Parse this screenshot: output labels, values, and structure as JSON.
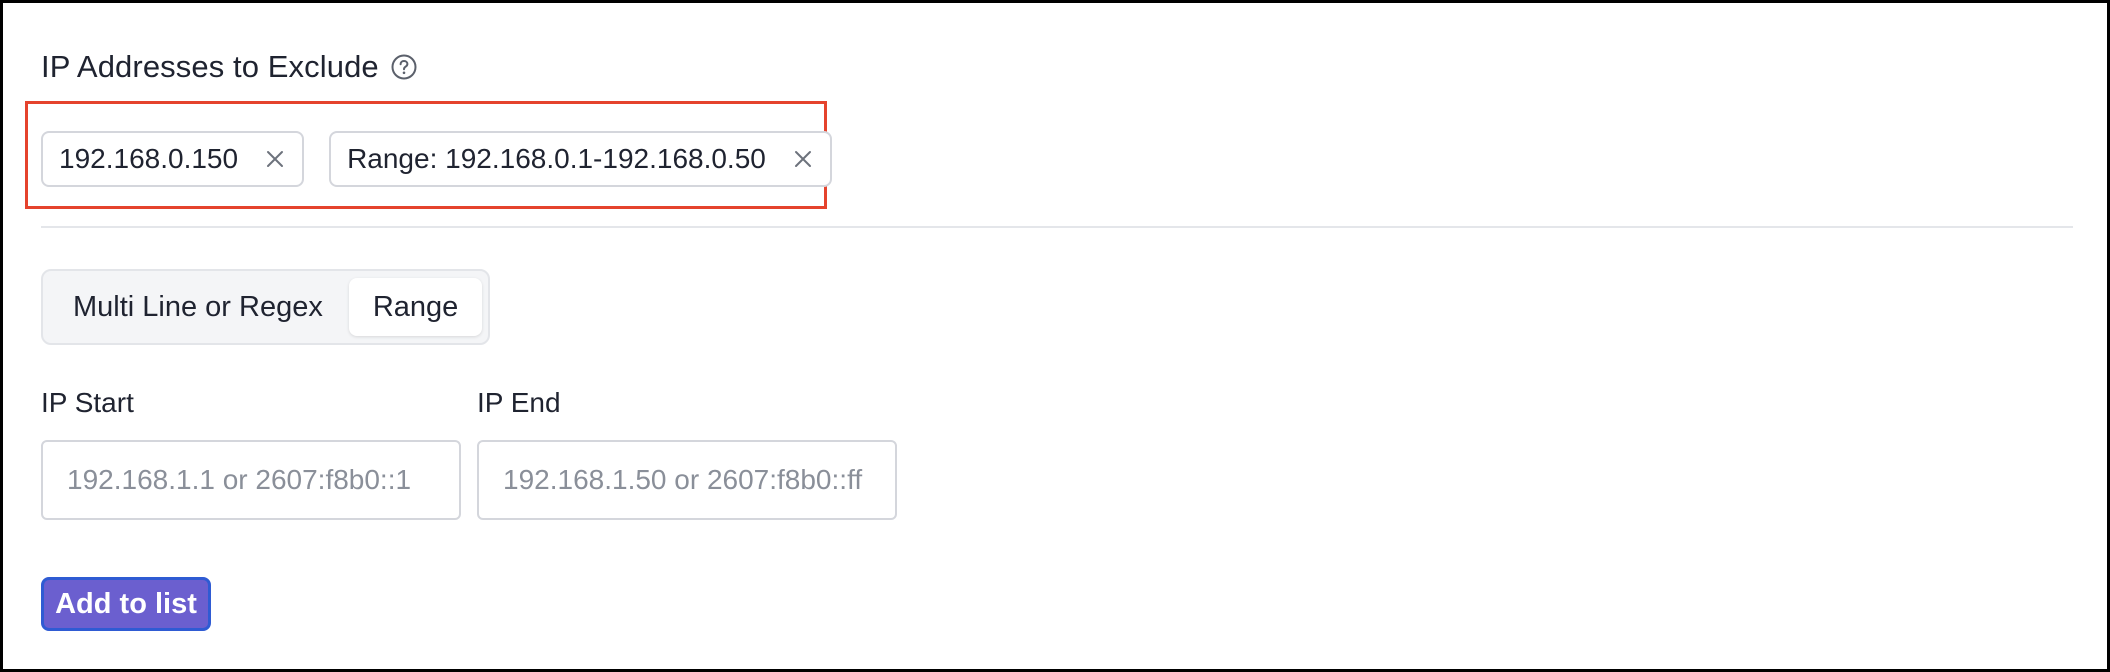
{
  "section": {
    "title": "IP Addresses to Exclude",
    "help_icon": "question-circle-icon"
  },
  "chips": [
    {
      "label": "192.168.0.150",
      "remove_icon": "close-icon"
    },
    {
      "label": "Range: 192.168.0.1-192.168.0.50",
      "remove_icon": "close-icon"
    }
  ],
  "mode_toggle": {
    "options": [
      "Multi Line or Regex",
      "Range"
    ],
    "selected": "Range"
  },
  "ip_start": {
    "label": "IP Start",
    "value": "",
    "placeholder": "192.168.1.1 or 2607:f8b0::1"
  },
  "ip_end": {
    "label": "IP End",
    "value": "",
    "placeholder": "192.168.1.50 or 2607:f8b0::ff"
  },
  "add_button": {
    "label": "Add to list"
  },
  "colors": {
    "highlight_border": "#e5432d",
    "button_bg": "#6b5fcf",
    "button_border": "#2f5bd3",
    "text": "#1f2330"
  }
}
